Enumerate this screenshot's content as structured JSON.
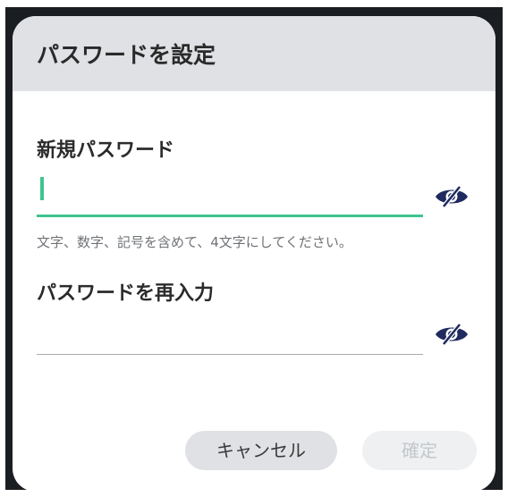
{
  "dialog": {
    "title": "パスワードを設定",
    "new_password": {
      "label": "新規パスワード",
      "value": "",
      "hint": "文字、数字、記号を含めて、4文字にしてください。",
      "visibility_icon": "eye-slash-icon"
    },
    "confirm_password": {
      "label": "パスワードを再入力",
      "value": "",
      "visibility_icon": "eye-slash-icon"
    },
    "buttons": {
      "cancel": "キャンセル",
      "confirm": "確定"
    }
  },
  "colors": {
    "accent": "#3fc48e",
    "icon": "#1f2a5e",
    "header_bg": "#dfe1e4",
    "backdrop": "#1a1d21",
    "disabled_text": "#c4c7cb"
  }
}
